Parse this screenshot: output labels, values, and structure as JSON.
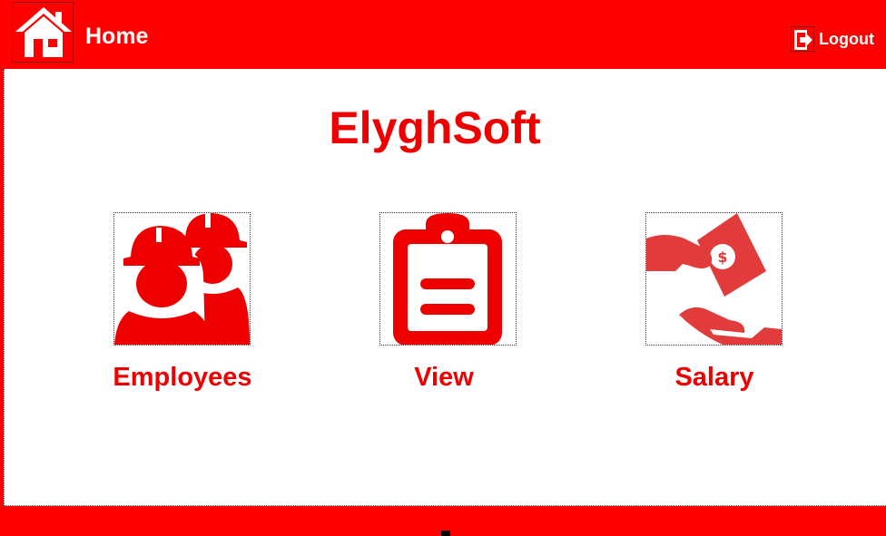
{
  "header": {
    "title": "Home",
    "home_icon": "home-icon",
    "logout_label": "Logout",
    "logout_icon": "logout-icon"
  },
  "brand": {
    "name": "ElyghSoft"
  },
  "menu": {
    "items": [
      {
        "label": "Employees",
        "icon": "workers-icon"
      },
      {
        "label": "View",
        "icon": "clipboard-icon"
      },
      {
        "label": "Salary",
        "icon": "money-hand-icon"
      }
    ]
  },
  "colors": {
    "primary": "#ff0000",
    "text_red": "#ee0000",
    "background": "#ffffff"
  }
}
